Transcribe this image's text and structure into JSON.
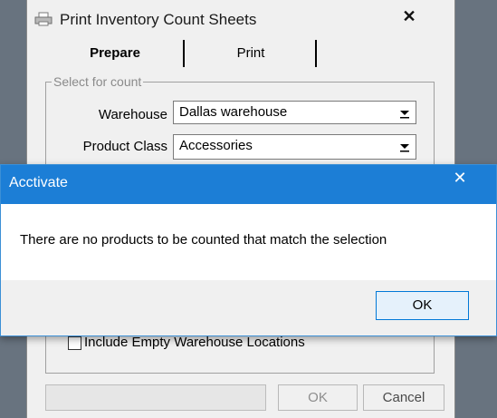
{
  "background_window": {
    "title": "Print Inventory Count Sheets",
    "close_glyph": "✕",
    "title_icon": "printer-icon",
    "tabs": [
      {
        "label": "Prepare",
        "active": true
      },
      {
        "label": "Print",
        "active": false
      }
    ],
    "group_label": "Select for count",
    "warehouse": {
      "label": "Warehouse",
      "value": "Dallas warehouse"
    },
    "product_class": {
      "label": "Product Class",
      "value": "Accessories"
    },
    "include_empty_locations": {
      "label": "Include Empty Warehouse Locations",
      "checked": false
    },
    "buttons": {
      "ok": "OK",
      "cancel": "Cancel"
    }
  },
  "dialog": {
    "title": "Acctivate",
    "close_glyph": "✕",
    "message": "There are no products to be counted that match the selection",
    "ok_label": "OK"
  },
  "colors": {
    "desktop": "#68737f",
    "dialog_titlebar": "#1c7ed6",
    "focus_border": "#0078d7"
  }
}
